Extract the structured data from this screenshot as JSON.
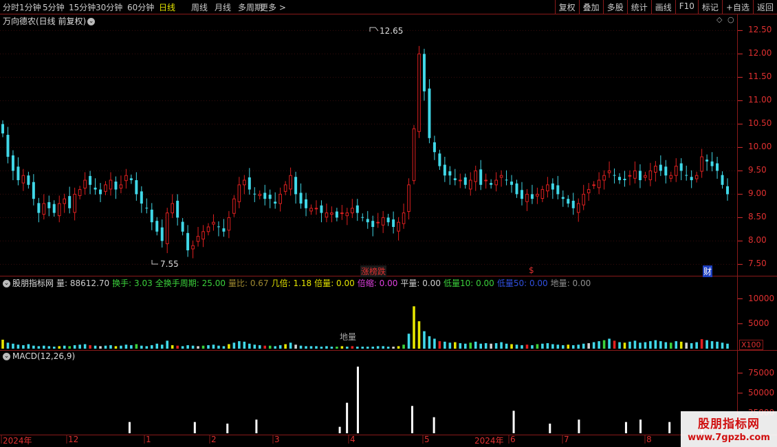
{
  "toolbar": {
    "timeframes": [
      "分时",
      "1分钟",
      "5分钟",
      "15分钟",
      "30分钟",
      "60分钟",
      "日线",
      "周线",
      "月线",
      "多周期",
      "更多 >"
    ],
    "active_index": 6,
    "right_buttons": [
      "复权",
      "叠加",
      "多股",
      "统计",
      "画线",
      "F10",
      "标记",
      "+自选",
      "返回"
    ]
  },
  "main_panel": {
    "title": "万向德农(日线 前复权)",
    "high_label": "12.65",
    "low_label": "7.55",
    "markers": [
      "涨榜跌",
      "$",
      "财"
    ],
    "y_ticks": [
      "12.50",
      "12.00",
      "11.50",
      "11.00",
      "10.50",
      "10.00",
      "9.50",
      "9.00",
      "8.50",
      "8.00",
      "7.50"
    ]
  },
  "volume_panel": {
    "title": "股朋指标网",
    "stats": [
      {
        "label": "量",
        "value": "88612.70",
        "color": "#d0d0d0"
      },
      {
        "label": "换手",
        "value": "3.03",
        "color": "#3bd13b"
      },
      {
        "label": "全换手周期",
        "value": "25.00",
        "color": "#3bd13b"
      },
      {
        "label": "量比",
        "value": "0.67",
        "color": "#a08a30"
      },
      {
        "label": "几倍",
        "value": "1.18",
        "color": "#e6e600"
      },
      {
        "label": "倍量",
        "value": "0.00",
        "color": "#e6e600"
      },
      {
        "label": "倍缩",
        "value": "0.00",
        "color": "#e040e0"
      },
      {
        "label": "平量",
        "value": "0.00",
        "color": "#d0d0d0"
      },
      {
        "label": "低量10",
        "value": "0.00",
        "color": "#3bd13b"
      },
      {
        "label": "低量50",
        "value": "0.00",
        "color": "#3050e0"
      },
      {
        "label": "地量",
        "value": "0.00",
        "color": "#909090"
      }
    ],
    "center_label": "地量",
    "y_ticks": [
      "10000",
      "5000"
    ],
    "unit": "X100"
  },
  "macd_panel": {
    "title": "MACD(12,26,9)",
    "y_ticks": [
      "75000",
      "50000",
      "25000"
    ]
  },
  "date_axis": {
    "labels": [
      "2024年",
      "12",
      "1",
      "2",
      "3",
      "4",
      "5",
      "2024年",
      "6",
      "7",
      "8"
    ]
  },
  "watermark": {
    "line1": "股朋指标网",
    "line2": "www.7gpzb.com"
  },
  "chart_data": {
    "type": "candlestick",
    "price_ylim": [
      7.3,
      12.8
    ],
    "closes": [
      10.3,
      9.8,
      9.5,
      9.3,
      9.4,
      9.2,
      8.9,
      8.6,
      8.8,
      8.7,
      8.6,
      8.8,
      8.9,
      8.7,
      9.0,
      9.1,
      9.3,
      9.2,
      9.1,
      9.0,
      9.2,
      9.3,
      9.1,
      9.2,
      9.4,
      9.3,
      9.0,
      8.8,
      8.7,
      8.4,
      8.2,
      8.0,
      8.6,
      8.8,
      8.5,
      8.2,
      7.8,
      7.9,
      8.1,
      8.2,
      8.3,
      8.4,
      8.3,
      8.2,
      8.5,
      8.9,
      9.2,
      9.3,
      9.1,
      9.0,
      9.0,
      8.9,
      8.9,
      8.8,
      9.0,
      9.2,
      9.4,
      9.0,
      8.8,
      8.7,
      8.7,
      8.7,
      8.6,
      8.6,
      8.6,
      8.5,
      8.6,
      8.6,
      8.7,
      8.6,
      8.5,
      8.4,
      8.3,
      8.4,
      8.5,
      8.4,
      8.3,
      8.4,
      8.6,
      9.2,
      10.4,
      12.0,
      11.2,
      10.2,
      9.9,
      9.6,
      9.4,
      9.4,
      9.3,
      9.3,
      9.2,
      9.3,
      9.5,
      9.2,
      9.3,
      9.2,
      9.3,
      9.4,
      9.3,
      9.2,
      9.0,
      8.9,
      9.0,
      8.9,
      9.0,
      9.1,
      9.2,
      9.1,
      9.0,
      8.9,
      8.8,
      8.7,
      8.8,
      9.0,
      9.1,
      9.2,
      9.3,
      9.4,
      9.5,
      9.4,
      9.3,
      9.3,
      9.4,
      9.5,
      9.3,
      9.4,
      9.5,
      9.6,
      9.5,
      9.4,
      9.4,
      9.6,
      9.5,
      9.4,
      9.3,
      9.4,
      9.8,
      9.7,
      9.6,
      9.5,
      9.2,
      9.0
    ],
    "volume_ylim": [
      0,
      12000
    ],
    "volumes": [
      1800,
      1200,
      1000,
      800,
      700,
      900,
      600,
      500,
      600,
      500,
      400,
      500,
      600,
      500,
      700,
      800,
      900,
      700,
      600,
      500,
      600,
      700,
      500,
      600,
      800,
      700,
      900,
      600,
      500,
      700,
      1000,
      800,
      1600,
      700,
      600,
      500,
      700,
      600,
      500,
      600,
      700,
      800,
      600,
      500,
      900,
      1200,
      1500,
      1400,
      1000,
      800,
      700,
      600,
      600,
      500,
      700,
      900,
      1200,
      800,
      600,
      500,
      500,
      500,
      400,
      500,
      400,
      400,
      500,
      400,
      500,
      400,
      400,
      400,
      400,
      500,
      500,
      400,
      400,
      500,
      800,
      3000,
      8500,
      5500,
      3500,
      2500,
      2000,
      1500,
      1400,
      1200,
      1300,
      1100,
      1000,
      1200,
      1400,
      1000,
      1100,
      1000,
      1100,
      1300,
      1000,
      900,
      800,
      700,
      800,
      700,
      900,
      1000,
      1100,
      900,
      800,
      700,
      800,
      700,
      800,
      1000,
      1100,
      1300,
      1500,
      1700,
      2000,
      1600,
      1300,
      1200,
      1400,
      1600,
      1200,
      1300,
      1500,
      1700,
      1500,
      1300,
      1200,
      1500,
      1400,
      1200,
      1100,
      1300,
      1900,
      1700,
      1500,
      1400,
      1200,
      1000
    ],
    "macd_ylim": [
      0,
      90000
    ],
    "macd_bars": [
      {
        "i": 35,
        "v": 14000
      },
      {
        "i": 53,
        "v": 14000
      },
      {
        "i": 62,
        "v": 12000
      },
      {
        "i": 70,
        "v": 17000
      },
      {
        "i": 93,
        "v": 8000
      },
      {
        "i": 95,
        "v": 38000
      },
      {
        "i": 98,
        "v": 83000
      },
      {
        "i": 113,
        "v": 34000
      },
      {
        "i": 119,
        "v": 20000
      },
      {
        "i": 141,
        "v": 28000
      },
      {
        "i": 151,
        "v": 12000
      },
      {
        "i": 159,
        "v": 17000
      },
      {
        "i": 172,
        "v": 14000
      },
      {
        "i": 176,
        "v": 17000
      },
      {
        "i": 184,
        "v": 14000
      },
      {
        "i": 193,
        "v": 6000
      }
    ]
  }
}
